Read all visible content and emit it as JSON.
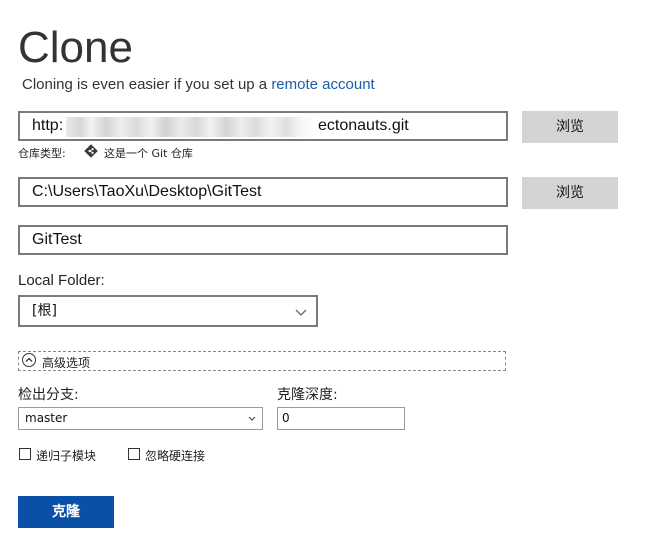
{
  "header": {
    "title": "Clone",
    "subtitle_text": "Cloning is even easier if you set up a ",
    "subtitle_link": "remote account"
  },
  "url_field": {
    "value_prefix": "http:",
    "value_suffix": "ectonauts.git",
    "browse_label": "浏览"
  },
  "repo_type": {
    "label": "仓库类型:",
    "icon": "git-diamond-icon",
    "text": "这是一个 Git 仓库"
  },
  "path_field": {
    "value": "C:\\Users\\TaoXu\\Desktop\\GitTest",
    "browse_label": "浏览"
  },
  "name_field": {
    "value": "GitTest"
  },
  "local_folder": {
    "label": "Local Folder:",
    "selected": "[根]"
  },
  "advanced": {
    "label": "高级选项",
    "icon": "chevron-up-icon"
  },
  "checkout_branch": {
    "label": "检出分支:",
    "selected": "master"
  },
  "clone_depth": {
    "label": "克隆深度:",
    "value": "0"
  },
  "options": {
    "recursive_label": "递归子模块",
    "ignore_hardlinks_label": "忽略硬连接"
  },
  "actions": {
    "clone_label": "克隆"
  },
  "colors": {
    "link": "#1a5fa8",
    "primary": "#0b50a8",
    "button_gray": "#d4d4d4"
  }
}
